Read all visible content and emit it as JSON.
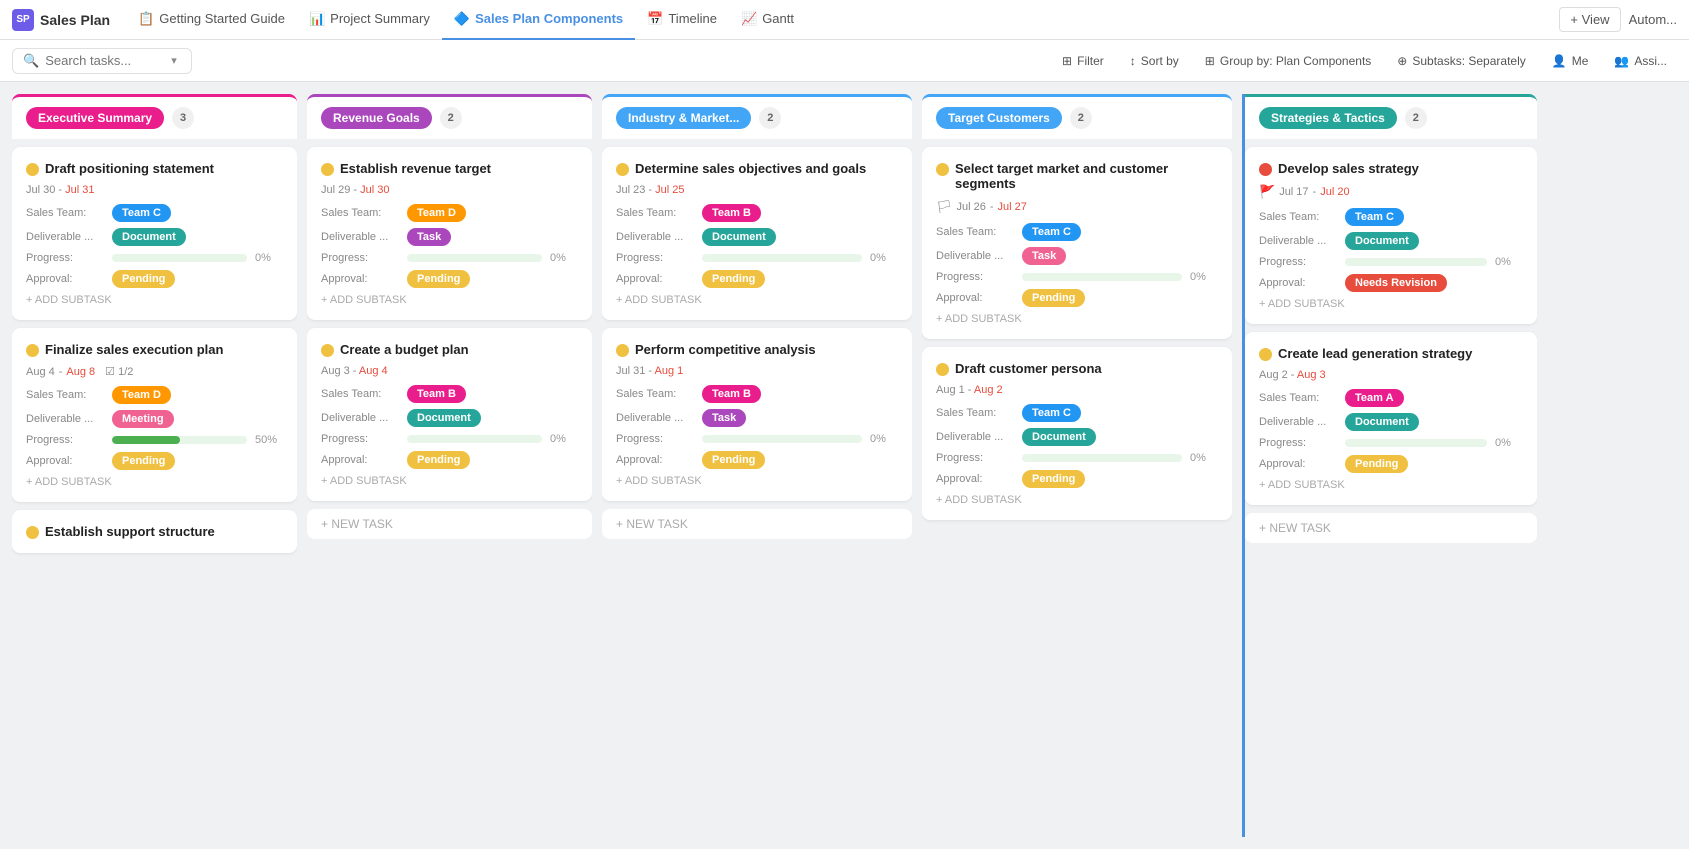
{
  "app": {
    "title": "Sales Plan",
    "logo_label": "SP"
  },
  "tabs": [
    {
      "id": "getting-started",
      "label": "Getting Started Guide",
      "icon": "📋",
      "active": false
    },
    {
      "id": "project-summary",
      "label": "Project Summary",
      "icon": "📊",
      "active": false
    },
    {
      "id": "sales-plan-components",
      "label": "Sales Plan Components",
      "icon": "🔷",
      "active": true
    },
    {
      "id": "timeline",
      "label": "Timeline",
      "icon": "📅",
      "active": false
    },
    {
      "id": "gantt",
      "label": "Gantt",
      "icon": "📈",
      "active": false
    }
  ],
  "toolbar": {
    "search_placeholder": "Search tasks...",
    "filter_label": "Filter",
    "sort_by_label": "Sort by",
    "group_by_label": "Group by: Plan Components",
    "subtasks_label": "Subtasks: Separately",
    "me_label": "Me",
    "assignee_label": "Assi..."
  },
  "columns": [
    {
      "id": "executive-summary",
      "title": "Executive Summary",
      "color": "#e91e8c",
      "border_color": "#e91e8c",
      "count": 3,
      "cards": [
        {
          "id": "card-1",
          "title": "Draft positioning statement",
          "dot_color": "#f0c040",
          "date_start": "Jul 30",
          "date_end": "Jul 31",
          "date_end_color": "red",
          "flag": false,
          "sales_team_label": "Sales Team:",
          "team": "Team C",
          "team_color": "#2196f3",
          "deliverable_label": "Deliverable ...",
          "deliverable": "Document",
          "deliverable_color": "#26a69a",
          "progress_label": "Progress:",
          "progress_pct": "0%",
          "progress_fill": 0,
          "approval_label": "Approval:",
          "approval": "Pending",
          "approval_type": "pending",
          "subtask_label": "+ ADD SUBTASK",
          "subtask_check": null
        },
        {
          "id": "card-2",
          "title": "Finalize sales execution plan",
          "dot_color": "#f0c040",
          "date_start": "Aug 4",
          "date_end": "Aug 8",
          "date_end_color": "red",
          "flag": false,
          "sales_team_label": "Sales Team:",
          "team": "Team D",
          "team_color": "#ff9800",
          "deliverable_label": "Deliverable ...",
          "deliverable": "Meeting",
          "deliverable_color": "#f06292",
          "progress_label": "Progress:",
          "progress_pct": "50%",
          "progress_fill": 50,
          "approval_label": "Approval:",
          "approval": "Pending",
          "approval_type": "pending",
          "subtask_label": "+ ADD SUBTASK",
          "subtask_check": "1/2"
        },
        {
          "id": "card-3",
          "title": "Establish support structure",
          "dot_color": "#f0c040",
          "date_start": null,
          "date_end": null,
          "date_end_color": null,
          "flag": false,
          "sales_team_label": null,
          "team": null,
          "team_color": null,
          "deliverable_label": null,
          "deliverable": null,
          "deliverable_color": null,
          "progress_label": null,
          "progress_pct": null,
          "progress_fill": 0,
          "approval_label": null,
          "approval": null,
          "approval_type": null,
          "subtask_label": null,
          "subtask_check": null
        }
      ]
    },
    {
      "id": "revenue-goals",
      "title": "Revenue Goals",
      "color": "#ab47bc",
      "border_color": "#ab47bc",
      "count": 2,
      "cards": [
        {
          "id": "card-4",
          "title": "Establish revenue target",
          "dot_color": "#f0c040",
          "date_start": "Jul 29",
          "date_end": "Jul 30",
          "date_end_color": "red",
          "flag": false,
          "sales_team_label": "Sales Team:",
          "team": "Team D",
          "team_color": "#ff9800",
          "deliverable_label": "Deliverable ...",
          "deliverable": "Task",
          "deliverable_color": "#ab47bc",
          "progress_label": "Progress:",
          "progress_pct": "0%",
          "progress_fill": 0,
          "approval_label": "Approval:",
          "approval": "Pending",
          "approval_type": "pending",
          "subtask_label": "+ ADD SUBTASK",
          "subtask_check": null
        },
        {
          "id": "card-5",
          "title": "Create a budget plan",
          "dot_color": "#f0c040",
          "date_start": "Aug 3",
          "date_end": "Aug 4",
          "date_end_color": "red",
          "flag": false,
          "sales_team_label": "Sales Team:",
          "team": "Team B",
          "team_color": "#e91e8c",
          "deliverable_label": "Deliverable ...",
          "deliverable": "Document",
          "deliverable_color": "#26a69a",
          "progress_label": "Progress:",
          "progress_pct": "0%",
          "progress_fill": 0,
          "approval_label": "Approval:",
          "approval": "Pending",
          "approval_type": "pending",
          "subtask_label": "+ ADD SUBTASK",
          "subtask_check": null
        }
      ],
      "new_task_label": "+ NEW TASK"
    },
    {
      "id": "industry-market",
      "title": "Industry & Market...",
      "color": "#42a5f5",
      "border_color": "#42a5f5",
      "count": 2,
      "cards": [
        {
          "id": "card-6",
          "title": "Determine sales objectives and goals",
          "dot_color": "#f0c040",
          "date_start": "Jul 23",
          "date_end": "Jul 25",
          "date_end_color": "red",
          "flag": false,
          "sales_team_label": "Sales Team:",
          "team": "Team B",
          "team_color": "#e91e8c",
          "deliverable_label": "Deliverable ...",
          "deliverable": "Document",
          "deliverable_color": "#26a69a",
          "progress_label": "Progress:",
          "progress_pct": "0%",
          "progress_fill": 0,
          "approval_label": "Approval:",
          "approval": "Pending",
          "approval_type": "pending",
          "subtask_label": "+ ADD SUBTASK",
          "subtask_check": null
        },
        {
          "id": "card-7",
          "title": "Perform competitive analysis",
          "dot_color": "#f0c040",
          "date_start": "Jul 31",
          "date_end": "Aug 1",
          "date_end_color": "red",
          "flag": false,
          "sales_team_label": "Sales Team:",
          "team": "Team B",
          "team_color": "#e91e8c",
          "deliverable_label": "Deliverable ...",
          "deliverable": "Task",
          "deliverable_color": "#ab47bc",
          "progress_label": "Progress:",
          "progress_pct": "0%",
          "progress_fill": 0,
          "approval_label": "Approval:",
          "approval": "Pending",
          "approval_type": "pending",
          "subtask_label": "+ ADD SUBTASK",
          "subtask_check": null
        }
      ],
      "new_task_label": "+ NEW TASK"
    },
    {
      "id": "target-customers",
      "title": "Target Customers",
      "color": "#42a5f5",
      "border_color": "#42a5f5",
      "count": 2,
      "cards": [
        {
          "id": "card-8",
          "title": "Select target market and customer segments",
          "dot_color": "#f0c040",
          "date_start": "Jul 26",
          "date_end": "Jul 27",
          "date_end_color": "red",
          "flag": true,
          "sales_team_label": "Sales Team:",
          "team": "Team C",
          "team_color": "#2196f3",
          "deliverable_label": "Deliverable ...",
          "deliverable": "Task",
          "deliverable_color": "#f06292",
          "progress_label": "Progress:",
          "progress_pct": "0%",
          "progress_fill": 0,
          "approval_label": "Approval:",
          "approval": "Pending",
          "approval_type": "pending",
          "subtask_label": "+ ADD SUBTASK",
          "subtask_check": null
        },
        {
          "id": "card-9",
          "title": "Draft customer persona",
          "dot_color": "#f0c040",
          "date_start": "Aug 1",
          "date_end": "Aug 2",
          "date_end_color": "red",
          "flag": false,
          "sales_team_label": "Sales Team:",
          "team": "Team C",
          "team_color": "#2196f3",
          "deliverable_label": "Deliverable ...",
          "deliverable": "Document",
          "deliverable_color": "#26a69a",
          "progress_label": "Progress:",
          "progress_pct": "0%",
          "progress_fill": 0,
          "approval_label": "Approval:",
          "approval": "Pending",
          "approval_type": "pending",
          "subtask_label": "+ ADD SUBTASK",
          "subtask_check": null
        }
      ]
    },
    {
      "id": "strategies-tactics",
      "title": "Strategies & Tactics",
      "color": "#26a69a",
      "border_color": "#4a90e2",
      "count": 2,
      "left_border": true,
      "cards": [
        {
          "id": "card-10",
          "title": "Develop sales strategy",
          "dot_color": "#e74c3c",
          "date_start": "Jul 17",
          "date_end": "Jul 20",
          "date_end_color": "red",
          "flag": true,
          "flag_color": "red",
          "sales_team_label": "Sales Team:",
          "team": "Team C",
          "team_color": "#2196f3",
          "deliverable_label": "Deliverable ...",
          "deliverable": "Document",
          "deliverable_color": "#26a69a",
          "progress_label": "Progress:",
          "progress_pct": "0%",
          "progress_fill": 0,
          "approval_label": "Approval:",
          "approval": "Needs Revision",
          "approval_type": "needs-revision",
          "subtask_label": "+ ADD SUBTASK",
          "subtask_check": null
        },
        {
          "id": "card-11",
          "title": "Create lead generation strategy",
          "dot_color": "#f0c040",
          "date_start": "Aug 2",
          "date_end": "Aug 3",
          "date_end_color": "red",
          "flag": false,
          "sales_team_label": "Sales Team:",
          "team": "Team A",
          "team_color": "#e91e8c",
          "deliverable_label": "Deliverable ...",
          "deliverable": "Document",
          "deliverable_color": "#26a69a",
          "progress_label": "Progress:",
          "progress_pct": "0%",
          "progress_fill": 0,
          "approval_label": "Approval:",
          "approval": "Pending",
          "approval_type": "pending",
          "subtask_label": "+ ADD SUBTASK",
          "subtask_check": null
        }
      ],
      "new_task_label": "+ NEW TASK"
    }
  ],
  "view_btn_label": "+ View",
  "autom_label": "Autom..."
}
